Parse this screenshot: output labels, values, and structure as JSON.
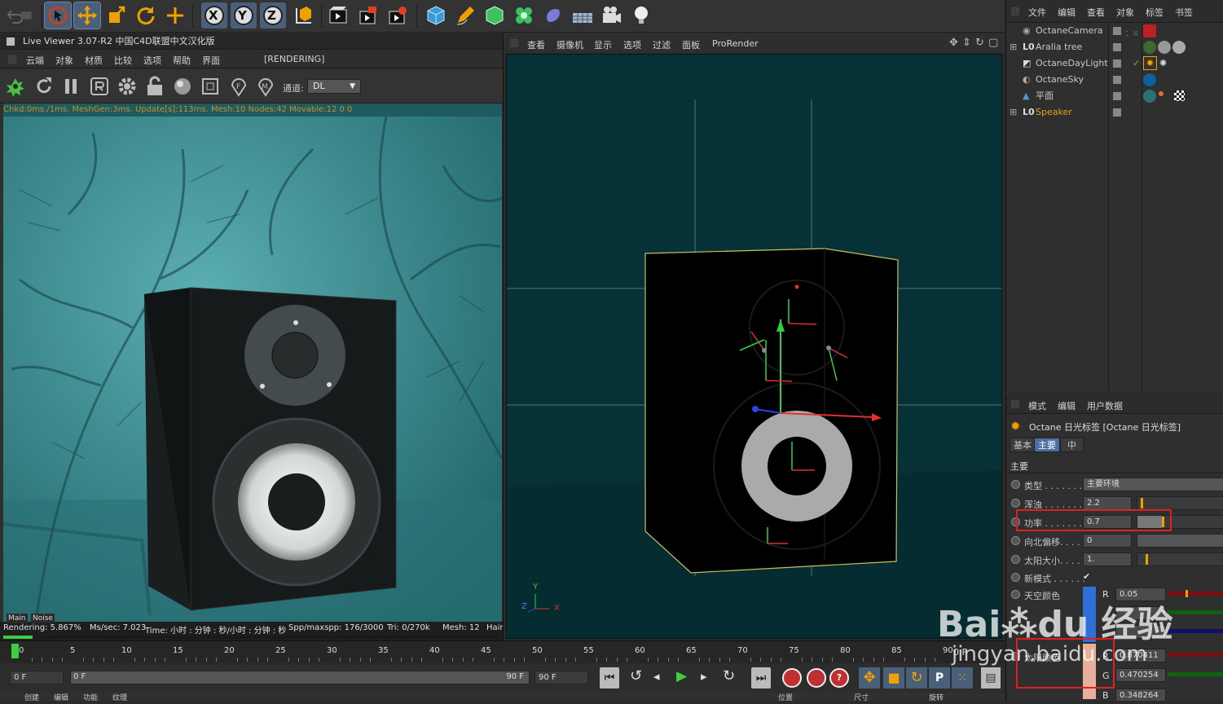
{
  "toolbar": {
    "icons": [
      "undo-icon",
      "redo-icon",
      "select-icon",
      "move-icon",
      "scale-icon",
      "rotate-icon",
      "multi-transform-icon",
      "x-axis-icon",
      "y-axis-icon",
      "z-axis-icon",
      "coordinate-system-icon",
      "render-view-icon",
      "render-picture-viewer-icon",
      "render-settings-icon",
      "cube-icon",
      "pen-icon",
      "subdivision-icon",
      "cloner-icon",
      "deformer-icon",
      "floor-icon",
      "camera-icon",
      "light-icon"
    ],
    "x_label": "X",
    "y_label": "Y",
    "z_label": "Z"
  },
  "live_viewer": {
    "title": "Live Viewer 3.07-R2 中国C4D联盟中文汉化版",
    "menu": [
      "云端",
      "对象",
      "材质",
      "比较",
      "选项",
      "帮助",
      "界面"
    ],
    "rendering_flag": "[RENDERING]",
    "channel_label": "通道:",
    "channel_value": "DL",
    "status_line": "Chkd:0ms./1ms. MeshGen:3ms. Update[s]:113ms. Mesh:10 Nodes:42 Movable:12  0 0",
    "tabs": [
      "Main",
      "Noise"
    ],
    "bottom": {
      "rendering": "Rendering: 5.867%",
      "ms_sec": "Ms/sec: 7.023",
      "time": "Time: 小时 : 分钟 : 秒/小时 : 分钟 : 秒",
      "spp": "Spp/maxspp: 176/3000",
      "tri": "Tri: 0/270k",
      "mesh": "Mesh: 12",
      "hair": "Hair"
    },
    "progress": 0.059
  },
  "viewport": {
    "menu": [
      "查看",
      "摄像机",
      "显示",
      "选项",
      "过滤",
      "面板",
      "ProRender"
    ],
    "axis_y": "Y",
    "axis_z": "Z",
    "axis_x": "X"
  },
  "timeline": {
    "ticks": [
      "0",
      "5",
      "10",
      "15",
      "20",
      "25",
      "30",
      "35",
      "40",
      "45",
      "50",
      "55",
      "60",
      "65",
      "70",
      "75",
      "80",
      "85",
      "90"
    ],
    "end_label": "0 F",
    "current_frame": "0 F",
    "range_start": "0 F",
    "range_end": "90 F",
    "max_frame": "90 F"
  },
  "bottom_tabs": [
    "创建",
    "编辑",
    "功能",
    "纹理",
    "位置",
    "尺寸",
    "旋转"
  ],
  "object_manager": {
    "menu": [
      "文件",
      "编辑",
      "查看",
      "对象",
      "标签",
      "书签"
    ],
    "objects": [
      {
        "name": "OctaneCamera",
        "color": "#cfcfcf"
      },
      {
        "name": "Aralia tree",
        "color": "#cfcfcf"
      },
      {
        "name": "OctaneDayLight",
        "color": "#cfcfcf"
      },
      {
        "name": "OctaneSky",
        "color": "#cfcfcf"
      },
      {
        "name": "平面",
        "color": "#cfcfcf"
      },
      {
        "name": "Speaker",
        "color": "#e8a020"
      }
    ]
  },
  "attribute_manager": {
    "menu": [
      "模式",
      "编辑",
      "用户数据"
    ],
    "title": "Octane 日光标签 [Octane 日光标签]",
    "tabs": [
      "基本",
      "主要",
      "中"
    ],
    "section": "主要",
    "params": [
      {
        "label": "类型 . . . . . . . .",
        "value": "主要环境"
      },
      {
        "label": "浑浊 . . . . . . . .",
        "value": "2.2"
      },
      {
        "label": "功率 . . . . . . . .",
        "value": "0.7"
      },
      {
        "label": "向北偏移. . . . .",
        "value": "0"
      },
      {
        "label": "太阳大小. . . . .",
        "value": "1."
      },
      {
        "label": "新模式 . . . . . .",
        "value": "✔"
      }
    ],
    "sky_color": {
      "label": "天空颜色",
      "r_label": "R",
      "r": "0.05"
    },
    "sun_color": {
      "label": "太阳颜色",
      "r_label": "R",
      "r": "0.870411",
      "g_label": "G",
      "g": "0.470254",
      "b_label": "B",
      "b": "0.348264"
    }
  },
  "watermark": "Baidu经验 jingyan.baidu.com",
  "colors": {
    "accent": "#4a5f7a",
    "highlight": "#e02020",
    "render_bg": "#3a8a8e",
    "viewport_bg": "#063237"
  }
}
